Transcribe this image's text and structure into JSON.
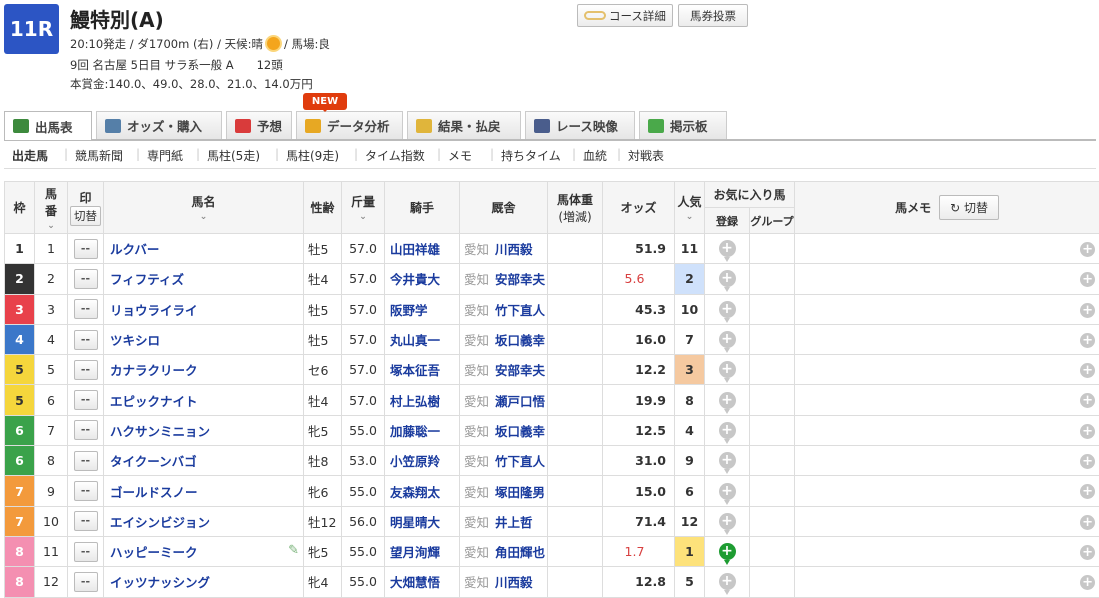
{
  "race": {
    "number": "11R",
    "name": "鰻特別(A)",
    "meta_before_sun": "20:10発走 / ダ1700m (右) / 天候:晴",
    "meta_after_sun": "/ 馬場:良",
    "line2": "9回 名古屋 5日目 サラ系一般 A　　12頭",
    "prize": "本賞金:140.0、49.0、28.0、21.0、14.0万円"
  },
  "buttons": {
    "course_detail": "コース詳細",
    "bet": "馬券投票"
  },
  "tabs": [
    {
      "label": "出馬表",
      "color": "#3d8a3d"
    },
    {
      "label": "オッズ・購入",
      "color": "#557fa8"
    },
    {
      "label": "予想",
      "color": "#d93b3b"
    },
    {
      "label": "データ分析",
      "color": "#e7a823"
    },
    {
      "label": "結果・払戻",
      "color": "#e0b53b"
    },
    {
      "label": "レース映像",
      "color": "#4a5d8c"
    },
    {
      "label": "掲示板",
      "color": "#4aa94a"
    }
  ],
  "new_badge": "NEW",
  "subnav": [
    "出走馬",
    "競馬新聞",
    "専門紙",
    "馬柱(5走)",
    "馬柱(9走)",
    "タイム指数",
    "メモ",
    "持ちタイム",
    "血統",
    "対戦表"
  ],
  "headers": {
    "waku": "枠",
    "umaban_1": "馬",
    "umaban_2": "番",
    "mark": "印",
    "mark_toggle": "切替",
    "horse": "馬名",
    "sexage": "性齢",
    "weight": "斤量",
    "jockey": "騎手",
    "trainer": "厩舎",
    "body_weight": "馬体重",
    "body_weight_sub": "(増減)",
    "odds": "オッズ",
    "ninki": "人気",
    "fav": "お気に入り馬",
    "fav_reg": "登録",
    "fav_group": "グループ",
    "memo": "馬メモ",
    "memo_toggle": "切替"
  },
  "mark_placeholder": "--",
  "waku_colors": {
    "1": {
      "bg": "#ffffff",
      "fg": "#333333"
    },
    "2": {
      "bg": "#333333",
      "fg": "#ffffff"
    },
    "3": {
      "bg": "#e8414b",
      "fg": "#ffffff"
    },
    "4": {
      "bg": "#3b77c9",
      "fg": "#ffffff"
    },
    "5": {
      "bg": "#f5d63c",
      "fg": "#333333"
    },
    "6": {
      "bg": "#3aa24a",
      "fg": "#ffffff"
    },
    "7": {
      "bg": "#f39a3c",
      "fg": "#ffffff"
    },
    "8": {
      "bg": "#f48fb1",
      "fg": "#ffffff"
    }
  },
  "rows": [
    {
      "waku": "1",
      "umaban": "1",
      "name": "ルクバー",
      "sexage": "牡5",
      "weight": "57.0",
      "jockey": "山田祥雄",
      "pref": "愛知",
      "trainer": "川西毅",
      "odds": "51.9",
      "ninki": "11",
      "fav": false,
      "icon": false
    },
    {
      "waku": "2",
      "umaban": "2",
      "name": "フィフティズ",
      "sexage": "牡4",
      "weight": "57.0",
      "jockey": "今井貴大",
      "pref": "愛知",
      "trainer": "安部幸夫",
      "odds": "5.6",
      "ninki": "2",
      "fav": false,
      "icon": false
    },
    {
      "waku": "3",
      "umaban": "3",
      "name": "リョウライライ",
      "sexage": "牡5",
      "weight": "57.0",
      "jockey": "阪野学",
      "pref": "愛知",
      "trainer": "竹下直人",
      "odds": "45.3",
      "ninki": "10",
      "fav": false,
      "icon": false
    },
    {
      "waku": "4",
      "umaban": "4",
      "name": "ツキシロ",
      "sexage": "牡5",
      "weight": "57.0",
      "jockey": "丸山真一",
      "pref": "愛知",
      "trainer": "坂口義幸",
      "odds": "16.0",
      "ninki": "7",
      "fav": false,
      "icon": false
    },
    {
      "waku": "5",
      "umaban": "5",
      "name": "カナラクリーク",
      "sexage": "セ6",
      "weight": "57.0",
      "jockey": "塚本征吾",
      "pref": "愛知",
      "trainer": "安部幸夫",
      "odds": "12.2",
      "ninki": "3",
      "fav": false,
      "icon": false
    },
    {
      "waku": "5",
      "umaban": "6",
      "name": "エピックナイト",
      "sexage": "牡4",
      "weight": "57.0",
      "jockey": "村上弘樹",
      "pref": "愛知",
      "trainer": "瀬戸口悟",
      "odds": "19.9",
      "ninki": "8",
      "fav": false,
      "icon": false
    },
    {
      "waku": "6",
      "umaban": "7",
      "name": "ハクサンミニョン",
      "sexage": "牝5",
      "weight": "55.0",
      "jockey": "加藤聡一",
      "pref": "愛知",
      "trainer": "坂口義幸",
      "odds": "12.5",
      "ninki": "4",
      "fav": false,
      "icon": false
    },
    {
      "waku": "6",
      "umaban": "8",
      "name": "タイクーンバゴ",
      "sexage": "牡8",
      "weight": "53.0",
      "jockey": "小笠原羚",
      "pref": "愛知",
      "trainer": "竹下直人",
      "odds": "31.0",
      "ninki": "9",
      "fav": false,
      "icon": false
    },
    {
      "waku": "7",
      "umaban": "9",
      "name": "ゴールドスノー",
      "sexage": "牝6",
      "weight": "55.0",
      "jockey": "友森翔太",
      "pref": "愛知",
      "trainer": "塚田隆男",
      "odds": "15.0",
      "ninki": "6",
      "fav": false,
      "icon": false
    },
    {
      "waku": "7",
      "umaban": "10",
      "name": "エイシンビジョン",
      "sexage": "牡12",
      "weight": "56.0",
      "jockey": "明星晴大",
      "pref": "愛知",
      "trainer": "井上哲",
      "odds": "71.4",
      "ninki": "12",
      "fav": false,
      "icon": false
    },
    {
      "waku": "8",
      "umaban": "11",
      "name": "ハッピーミーク",
      "sexage": "牝5",
      "weight": "55.0",
      "jockey": "望月洵輝",
      "pref": "愛知",
      "trainer": "角田輝也",
      "odds": "1.7",
      "ninki": "1",
      "fav": true,
      "icon": true
    },
    {
      "waku": "8",
      "umaban": "12",
      "name": "イッツナッシング",
      "sexage": "牝4",
      "weight": "55.0",
      "jockey": "大畑慧悟",
      "pref": "愛知",
      "trainer": "川西毅",
      "odds": "12.8",
      "ninki": "5",
      "fav": false,
      "icon": false
    }
  ]
}
